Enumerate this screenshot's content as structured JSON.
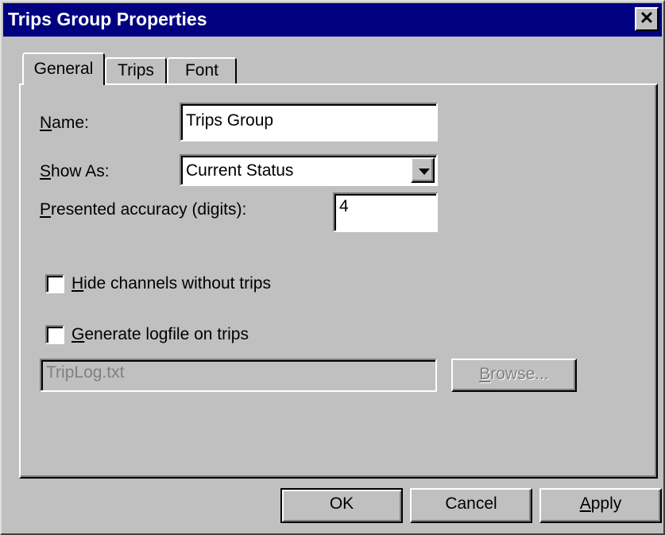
{
  "window": {
    "title": "Trips Group Properties",
    "close_label": "✕"
  },
  "tabs": [
    {
      "label": "General",
      "active": true
    },
    {
      "label": "Trips",
      "active": false
    },
    {
      "label": "Font",
      "active": false
    }
  ],
  "general": {
    "name_label_mnemonic": "N",
    "name_label_rest": "ame:",
    "name_value": "Trips Group",
    "show_as_label_mnemonic": "S",
    "show_as_label_rest": "how As:",
    "show_as_value": "Current Status",
    "accuracy_label_mnemonic": "P",
    "accuracy_label_rest": "resented accuracy (digits):",
    "accuracy_value": "4",
    "hide_channels_mnemonic": "H",
    "hide_channels_rest": "ide channels without trips",
    "hide_channels_checked": false,
    "logfile_mnemonic": "G",
    "logfile_rest": "enerate logfile on trips",
    "logfile_checked": false,
    "logfile_path": "TripLog.txt",
    "browse_mnemonic": "B",
    "browse_rest": "rowse..."
  },
  "buttons": {
    "ok": "OK",
    "cancel": "Cancel",
    "apply_mnemonic": "A",
    "apply_rest": "pply"
  },
  "colors": {
    "titlebar": "#000080",
    "face": "#c0c0c0"
  }
}
